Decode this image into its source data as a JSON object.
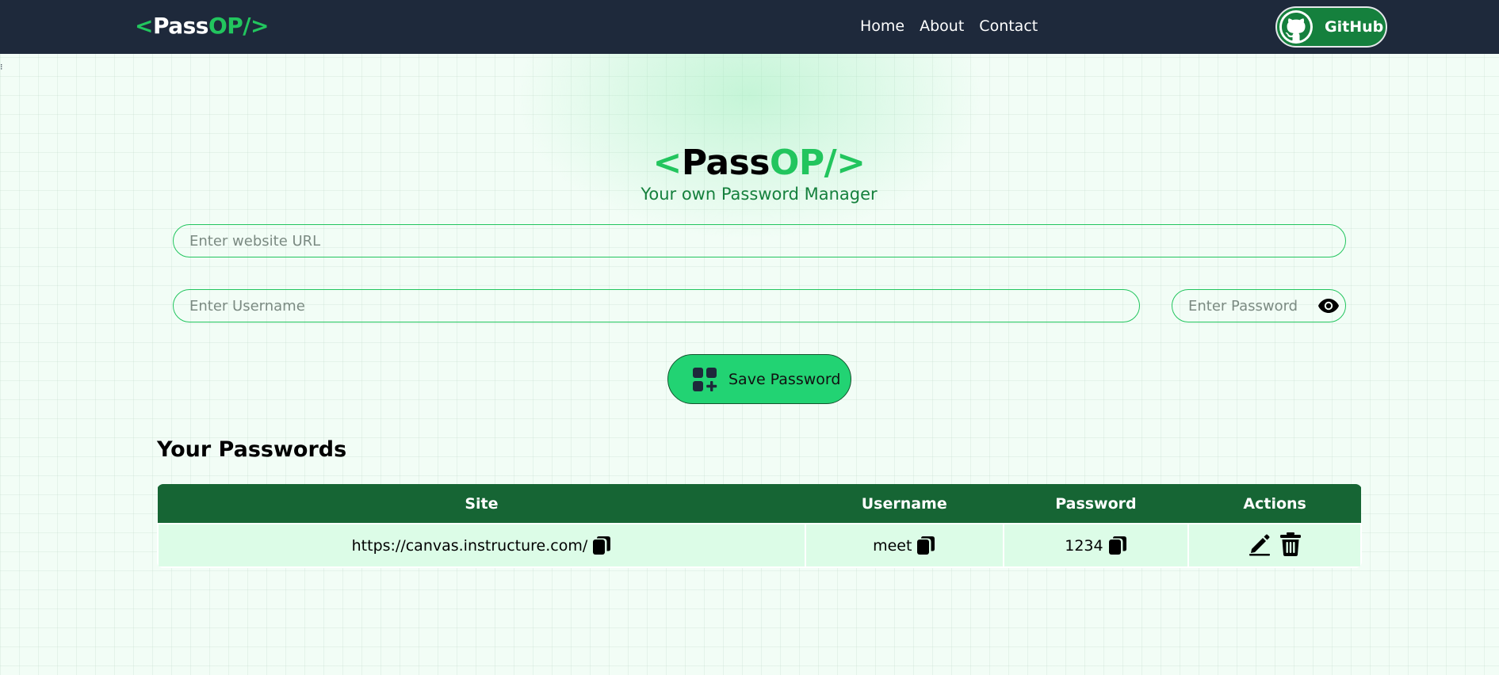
{
  "navbar": {
    "logo": {
      "open": "<",
      "pass": "Pass",
      "op": "OP/>"
    },
    "links": [
      "Home",
      "About",
      "Contact"
    ],
    "github_label": "GitHub"
  },
  "hero": {
    "title": {
      "open": "<",
      "pass": "Pass",
      "op": "OP/>"
    },
    "subtitle": "Your own Password Manager"
  },
  "form": {
    "url_placeholder": "Enter website URL",
    "username_placeholder": "Enter Username",
    "password_placeholder": "Enter Password",
    "save_label": "Save Password"
  },
  "passwords": {
    "title": "Your Passwords",
    "columns": [
      "Site",
      "Username",
      "Password",
      "Actions"
    ],
    "rows": [
      {
        "site": "https://canvas.instructure.com/",
        "username": "meet",
        "password": "1234"
      }
    ]
  },
  "colors": {
    "navbar_bg": "#1e293b",
    "accent_green": "#22c55e",
    "table_header": "#166534",
    "table_row": "#dcfce7",
    "save_button": "#22d373"
  },
  "icons": [
    "github-icon",
    "eye-icon",
    "add-grid-icon",
    "copy-icon",
    "edit-icon",
    "trash-icon"
  ]
}
